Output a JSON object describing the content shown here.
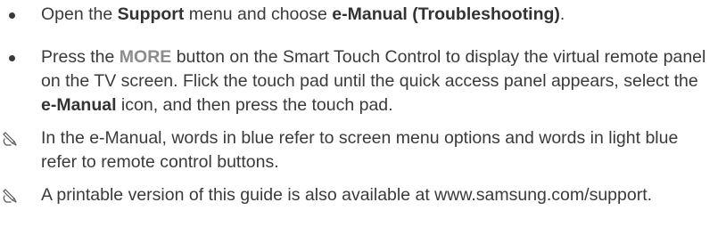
{
  "items": [
    {
      "type": "bullet",
      "parts": {
        "p1": "Open the ",
        "b1": "Support",
        "p2": " menu and choose ",
        "b2": "e-Manual (Troubleshooting)",
        "p3": "."
      }
    },
    {
      "type": "bullet",
      "parts": {
        "p1": "Press the ",
        "b1": "MORE",
        "p2": " button on the Smart Touch Control to display the virtual remote panel on the TV screen. Flick the touch pad until the quick access panel appears, select the ",
        "b2": "e-Manual",
        "p3": " icon, and then press the touch pad."
      }
    },
    {
      "type": "note",
      "icon": "pencil-note-icon",
      "text": "In the e-Manual, words in blue refer to screen menu options and words in light blue refer to remote control buttons."
    },
    {
      "type": "note",
      "icon": "pencil-note-icon",
      "text": "A printable version of this guide is also available at www.samsung.com/support."
    }
  ]
}
